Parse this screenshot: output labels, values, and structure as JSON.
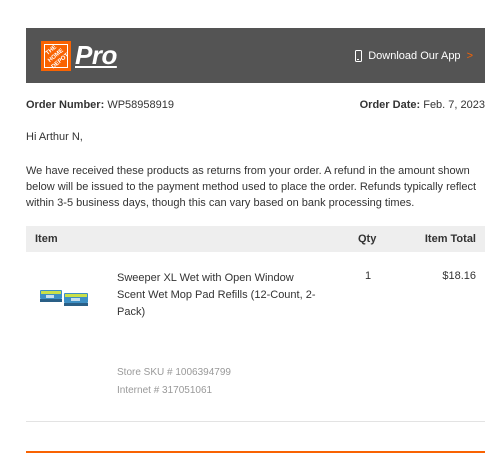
{
  "header": {
    "logo_text": "THE HOME DEPOT",
    "pro_label": "Pro",
    "app_link": "Download Our App",
    "app_link_chevron": ">",
    "background_color": "#545454",
    "brand_color": "#f96302"
  },
  "order": {
    "number_label": "Order Number:",
    "number": "WP58958919",
    "date_label": "Order Date:",
    "date": "Feb. 7, 2023"
  },
  "greeting": "Hi Arthur N,",
  "message": "We have received these products as returns from your order. A refund in the amount shown below will be issued to the payment method used to place the order. Refunds typically reflect within 3-5 business days, though this can vary based on bank processing times.",
  "table": {
    "headers": [
      "Item",
      "Qty",
      "Item Total"
    ],
    "rows": [
      {
        "name": "Sweeper XL Wet with Open Window Scent Wet Mop Pad Refills (12-Count, 2-Pack)",
        "qty": "1",
        "total": "$18.16",
        "store_sku": "Store SKU # 1006394799",
        "internet": "Internet # 317051061",
        "image": "mop-pad-refills-product-image"
      }
    ]
  }
}
